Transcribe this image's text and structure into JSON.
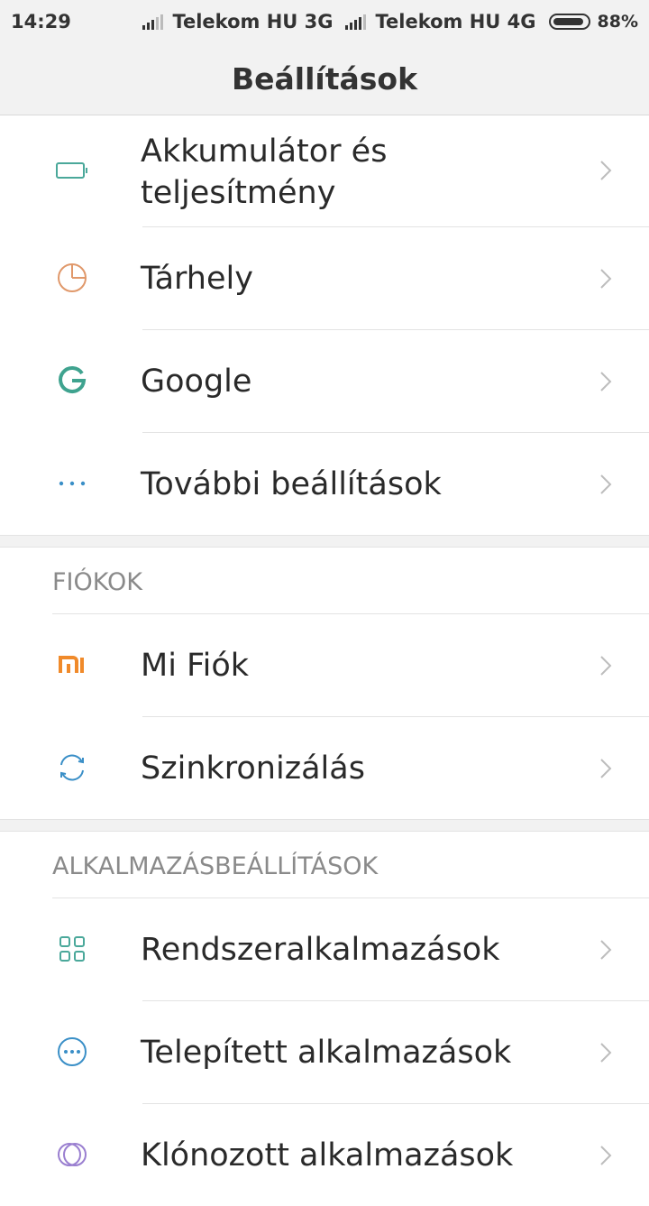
{
  "status_bar": {
    "time": "14:29",
    "carrier1": "Telekom HU 3G",
    "carrier2": "Telekom HU 4G",
    "battery": "88%",
    "battery_level": 0.88
  },
  "header": {
    "title": "Beállítások"
  },
  "items_top": [
    {
      "label_line1": "Akkumulátor és",
      "label_line2": "teljesítmény",
      "icon": "battery-icon",
      "color": "#4aa89a"
    },
    {
      "label": "Tárhely",
      "icon": "pie-chart-icon",
      "color": "#e0986a"
    },
    {
      "label": "Google",
      "icon": "google-icon",
      "color": "#3fa38f"
    },
    {
      "label": "További beállítások",
      "icon": "more-dots-icon",
      "color": "#3a8fc7"
    }
  ],
  "section_accounts": {
    "header": "FIÓKOK",
    "items": [
      {
        "label": "Mi Fiók",
        "icon": "mi-logo-icon",
        "color": "#f08a2a"
      },
      {
        "label": "Szinkronizálás",
        "icon": "sync-icon",
        "color": "#3a8fc7"
      }
    ]
  },
  "section_apps": {
    "header": "ALKALMAZÁSBEÁLLÍTÁSOK",
    "items": [
      {
        "label": "Rendszeralkalmazások",
        "icon": "grid-apps-icon",
        "color": "#4aa89a"
      },
      {
        "label": "Telepített alkalmazások",
        "icon": "chat-dots-icon",
        "color": "#3a8fc7"
      },
      {
        "label": "Klónozott alkalmazások",
        "icon": "clone-icon",
        "color": "#9a7fd0"
      }
    ]
  }
}
